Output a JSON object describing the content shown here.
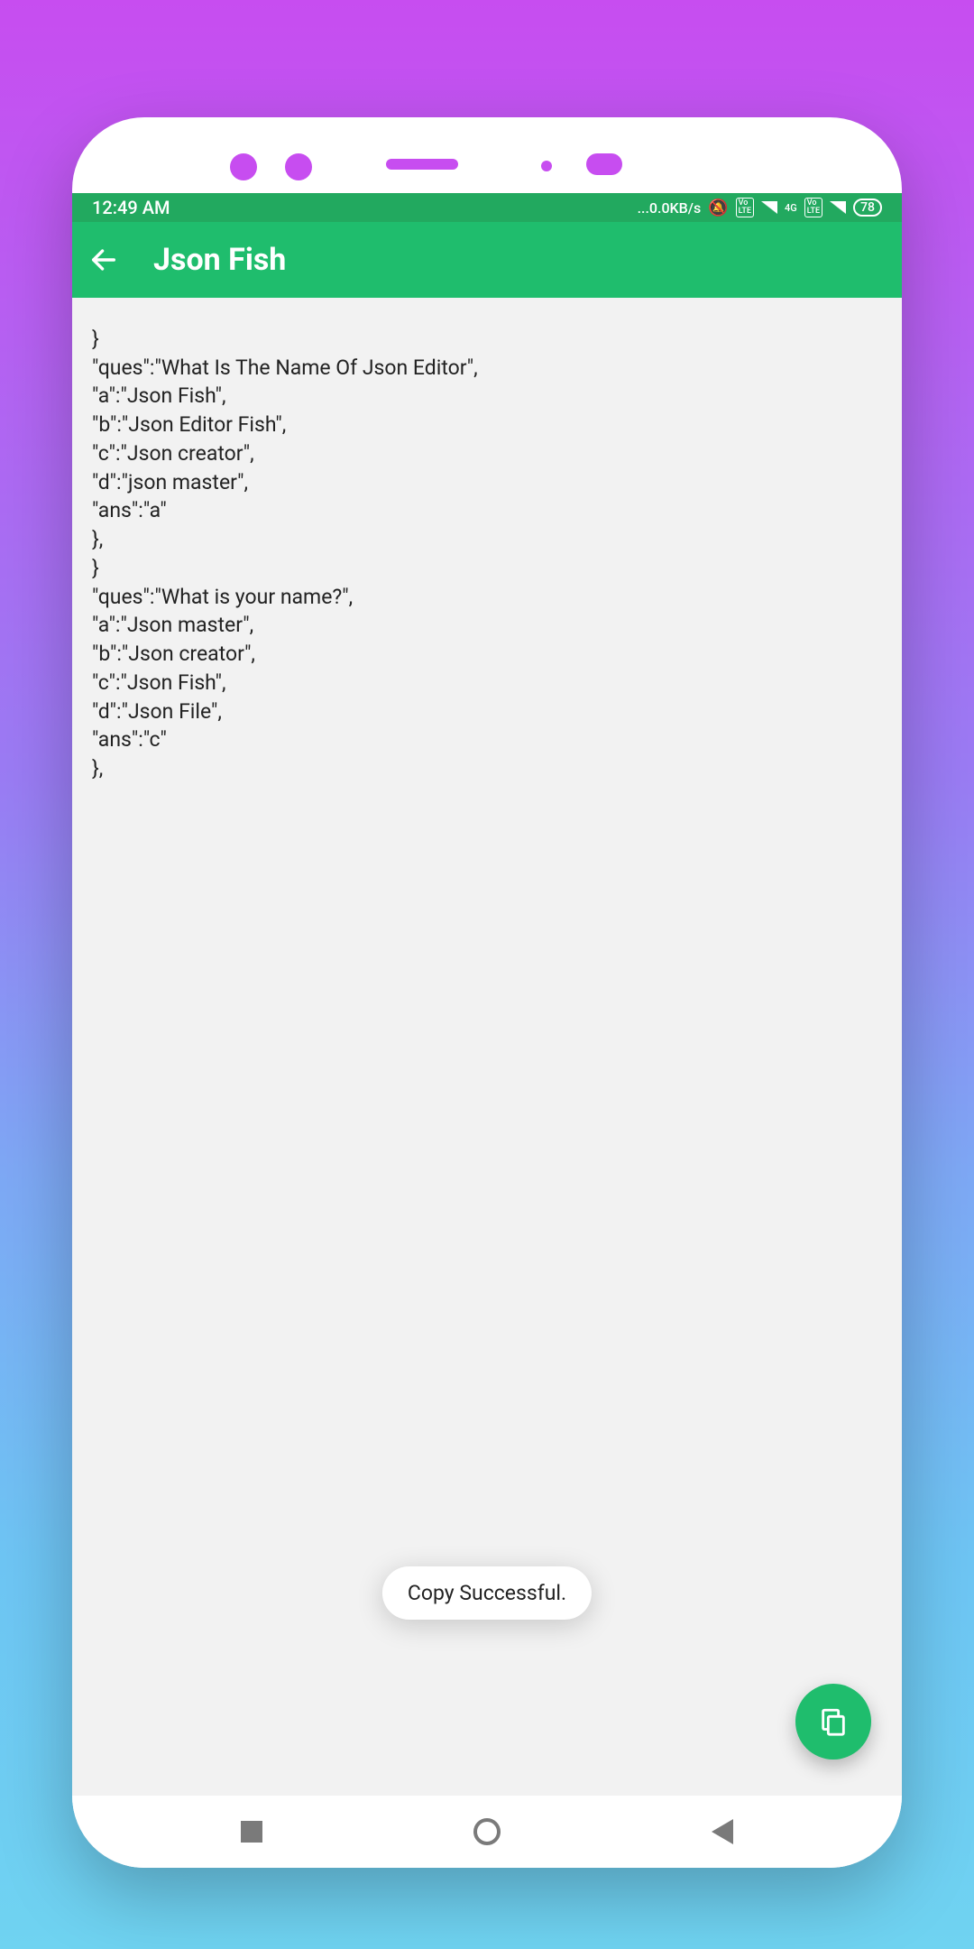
{
  "status": {
    "time": "12:49 AM",
    "net_speed": "...0.0KB/s",
    "battery": "78",
    "net_label": "4G"
  },
  "appbar": {
    "title": "Json Fish"
  },
  "content": {
    "text": "}\n\"ques\":\"What Is The Name Of Json Editor\",\n\"a\":\"Json Fish\",\n\"b\":\"Json Editor Fish\",\n\"c\":\"Json creator\",\n\"d\":\"json master\",\n\"ans\":\"a\"\n},\n}\n\"ques\":\"What is your name?\",\n\"a\":\"Json master\",\n\"b\":\"Json creator\",\n\"c\":\"Json Fish\",\n\"d\":\"Json File\",\n\"ans\":\"c\"\n},"
  },
  "toast": {
    "message": "Copy Successful."
  },
  "colors": {
    "accent": "#1fbd6d",
    "status": "#22a95f"
  }
}
